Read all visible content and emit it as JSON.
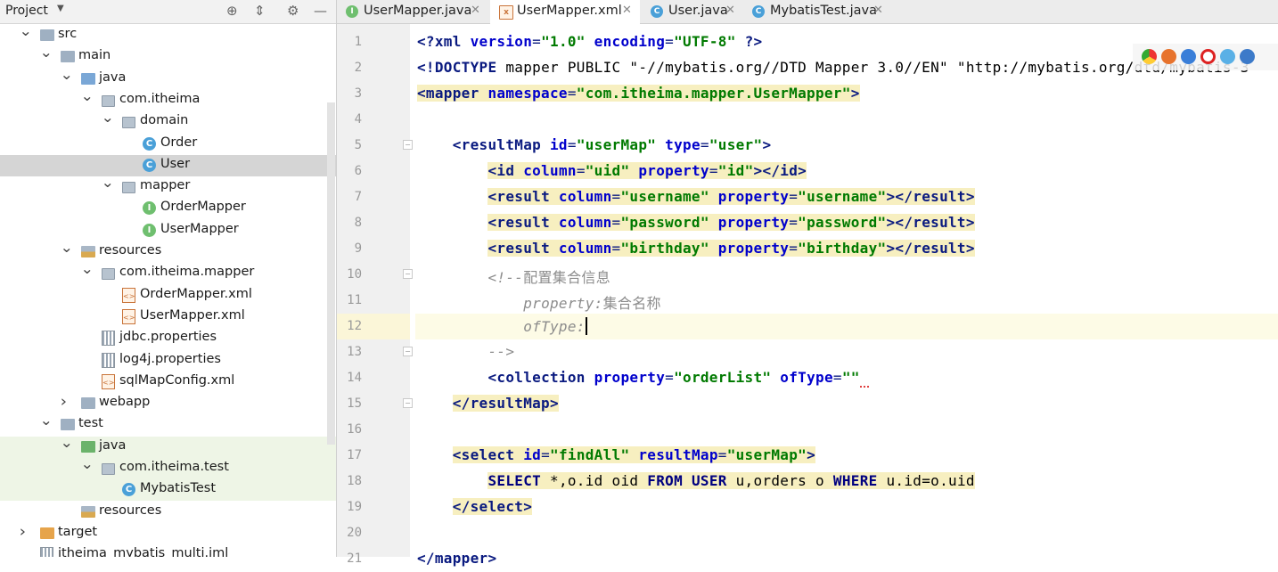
{
  "project_panel": {
    "title": "Project",
    "tree": [
      {
        "label": "src",
        "depth": 0,
        "open": true,
        "icon": "folder"
      },
      {
        "label": "main",
        "depth": 1,
        "open": true,
        "icon": "folder"
      },
      {
        "label": "java",
        "depth": 2,
        "open": true,
        "icon": "source-folder"
      },
      {
        "label": "com.itheima",
        "depth": 3,
        "open": true,
        "icon": "package"
      },
      {
        "label": "domain",
        "depth": 4,
        "open": true,
        "icon": "package"
      },
      {
        "label": "Order",
        "depth": 5,
        "icon": "class"
      },
      {
        "label": "User",
        "depth": 5,
        "icon": "class",
        "selected": true
      },
      {
        "label": "mapper",
        "depth": 4,
        "open": true,
        "icon": "package"
      },
      {
        "label": "OrderMapper",
        "depth": 5,
        "icon": "interface"
      },
      {
        "label": "UserMapper",
        "depth": 5,
        "icon": "interface"
      },
      {
        "label": "resources",
        "depth": 2,
        "open": true,
        "icon": "resources-folder"
      },
      {
        "label": "com.itheima.mapper",
        "depth": 3,
        "open": true,
        "icon": "package"
      },
      {
        "label": "OrderMapper.xml",
        "depth": 4,
        "icon": "xml"
      },
      {
        "label": "UserMapper.xml",
        "depth": 4,
        "icon": "xml"
      },
      {
        "label": "jdbc.properties",
        "depth": 3,
        "icon": "properties"
      },
      {
        "label": "log4j.properties",
        "depth": 3,
        "icon": "properties"
      },
      {
        "label": "sqlMapConfig.xml",
        "depth": 3,
        "icon": "xml"
      },
      {
        "label": "webapp",
        "depth": 2,
        "open": false,
        "icon": "folder"
      },
      {
        "label": "test",
        "depth": 1,
        "open": true,
        "icon": "folder"
      },
      {
        "label": "java",
        "depth": 2,
        "open": true,
        "icon": "test-source-folder",
        "test": true
      },
      {
        "label": "com.itheima.test",
        "depth": 3,
        "open": true,
        "icon": "package",
        "test": true
      },
      {
        "label": "MybatisTest",
        "depth": 4,
        "icon": "class",
        "test": true
      },
      {
        "label": "resources",
        "depth": 2,
        "icon": "test-resources-folder"
      },
      {
        "label": "target",
        "depth": 0,
        "open": false,
        "icon": "excluded-folder"
      },
      {
        "label": "itheima_mybatis_multi.iml",
        "depth": 0,
        "icon": "iml"
      }
    ]
  },
  "tabs": [
    {
      "label": "UserMapper.java",
      "icon": "interface",
      "active": false
    },
    {
      "label": "UserMapper.xml",
      "icon": "xml",
      "active": true
    },
    {
      "label": "User.java",
      "icon": "class",
      "active": false
    },
    {
      "label": "MybatisTest.java",
      "icon": "class",
      "active": false
    }
  ],
  "editor": {
    "current_line": 12,
    "lines": [
      {
        "n": "1",
        "text": "<?xml version=\"1.0\" encoding=\"UTF-8\" ?>"
      },
      {
        "n": "2",
        "text": "<!DOCTYPE mapper PUBLIC \"-//mybatis.org//DTD Mapper 3.0//EN\" \"http://mybatis.org/dtd/mybatis-3"
      },
      {
        "n": "3",
        "text": "<mapper namespace=\"com.itheima.mapper.UserMapper\">"
      },
      {
        "n": "4",
        "text": ""
      },
      {
        "n": "5",
        "text": "    <resultMap id=\"userMap\" type=\"user\">"
      },
      {
        "n": "6",
        "text": "        <id column=\"uid\" property=\"id\"></id>"
      },
      {
        "n": "7",
        "text": "        <result column=\"username\" property=\"username\"></result>"
      },
      {
        "n": "8",
        "text": "        <result column=\"password\" property=\"password\"></result>"
      },
      {
        "n": "9",
        "text": "        <result column=\"birthday\" property=\"birthday\"></result>"
      },
      {
        "n": "10",
        "text": "        <!--配置集合信息"
      },
      {
        "n": "11",
        "text": "            property:集合名称"
      },
      {
        "n": "12",
        "text": "            ofType:"
      },
      {
        "n": "13",
        "text": "        -->"
      },
      {
        "n": "14",
        "text": "        <collection property=\"orderList\" ofType=\"\""
      },
      {
        "n": "15",
        "text": "    </resultMap>"
      },
      {
        "n": "16",
        "text": ""
      },
      {
        "n": "17",
        "text": "    <select id=\"findAll\" resultMap=\"userMap\">"
      },
      {
        "n": "18",
        "text": "        SELECT *,o.id oid FROM USER u,orders o WHERE u.id=o.uid"
      },
      {
        "n": "19",
        "text": "    </select>"
      },
      {
        "n": "20",
        "text": ""
      },
      {
        "n": "21",
        "text": "</mapper>"
      }
    ]
  },
  "colors": {
    "tag": "#0a1a80",
    "attr": "#0000cc",
    "value": "#007a00",
    "comment": "#8c8c8c",
    "highlight": "#f7efc0",
    "selection_row": "#d5d5d5"
  }
}
